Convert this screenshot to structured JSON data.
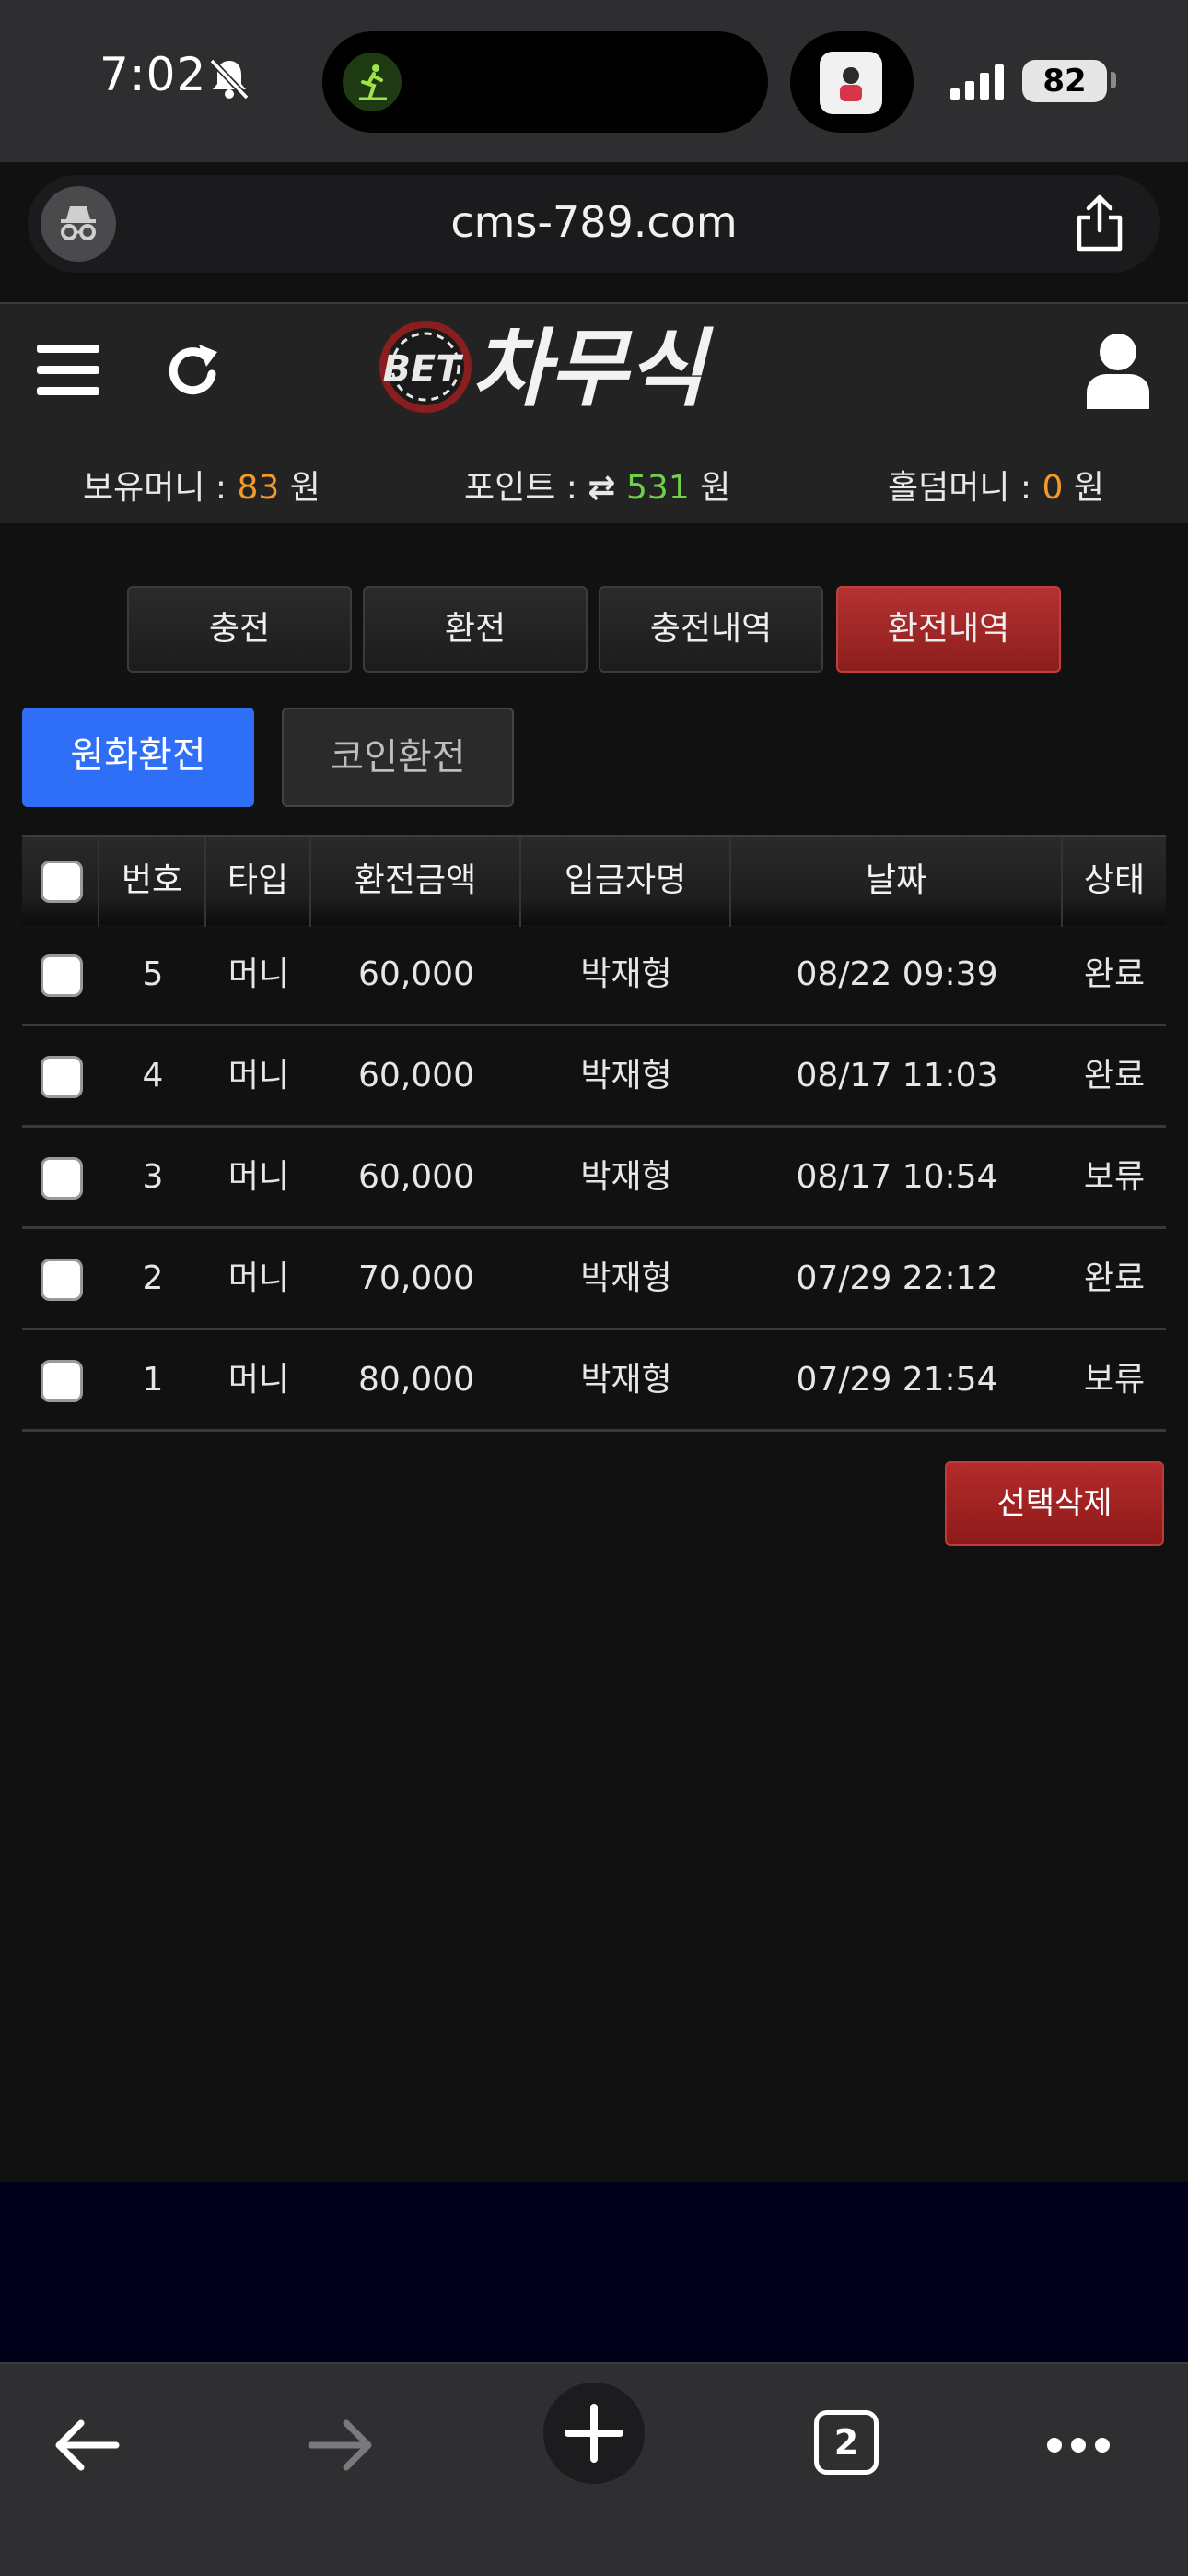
{
  "status": {
    "time": "7:02",
    "battery": "82"
  },
  "browser": {
    "url": "cms-789.com",
    "tab_count": "2"
  },
  "site": {
    "logo_prefix": "BET",
    "logo_name": "차무식",
    "balances": {
      "money_label": "보유머니 :",
      "money_value": "83",
      "money_unit": "원",
      "point_label": "포인트 :",
      "point_value": "531",
      "point_unit": "원",
      "holdem_label": "홀덤머니 :",
      "holdem_value": "0",
      "holdem_unit": "원"
    }
  },
  "tabs": [
    {
      "label": "충전",
      "active": false
    },
    {
      "label": "환전",
      "active": false
    },
    {
      "label": "충전내역",
      "active": false
    },
    {
      "label": "환전내역",
      "active": true
    }
  ],
  "subtabs": {
    "krw": "원화환전",
    "coin": "코인환전"
  },
  "table": {
    "headers": [
      "번호",
      "타입",
      "환전금액",
      "입금자명",
      "날짜",
      "상태"
    ],
    "rows": [
      {
        "no": "5",
        "type": "머니",
        "amount": "60,000",
        "name": "박재형",
        "date": "08/22 09:39",
        "status": "완료"
      },
      {
        "no": "4",
        "type": "머니",
        "amount": "60,000",
        "name": "박재형",
        "date": "08/17 11:03",
        "status": "완료"
      },
      {
        "no": "3",
        "type": "머니",
        "amount": "60,000",
        "name": "박재형",
        "date": "08/17 10:54",
        "status": "보류"
      },
      {
        "no": "2",
        "type": "머니",
        "amount": "70,000",
        "name": "박재형",
        "date": "07/29 22:12",
        "status": "완료"
      },
      {
        "no": "1",
        "type": "머니",
        "amount": "80,000",
        "name": "박재형",
        "date": "07/29 21:54",
        "status": "보류"
      }
    ]
  },
  "actions": {
    "delete_label": "선택삭제"
  },
  "colors": {
    "accent_blue": "#2f6ff7",
    "accent_red": "#b53131",
    "money_orange": "#f29b2b",
    "point_green": "#6fd14a"
  }
}
